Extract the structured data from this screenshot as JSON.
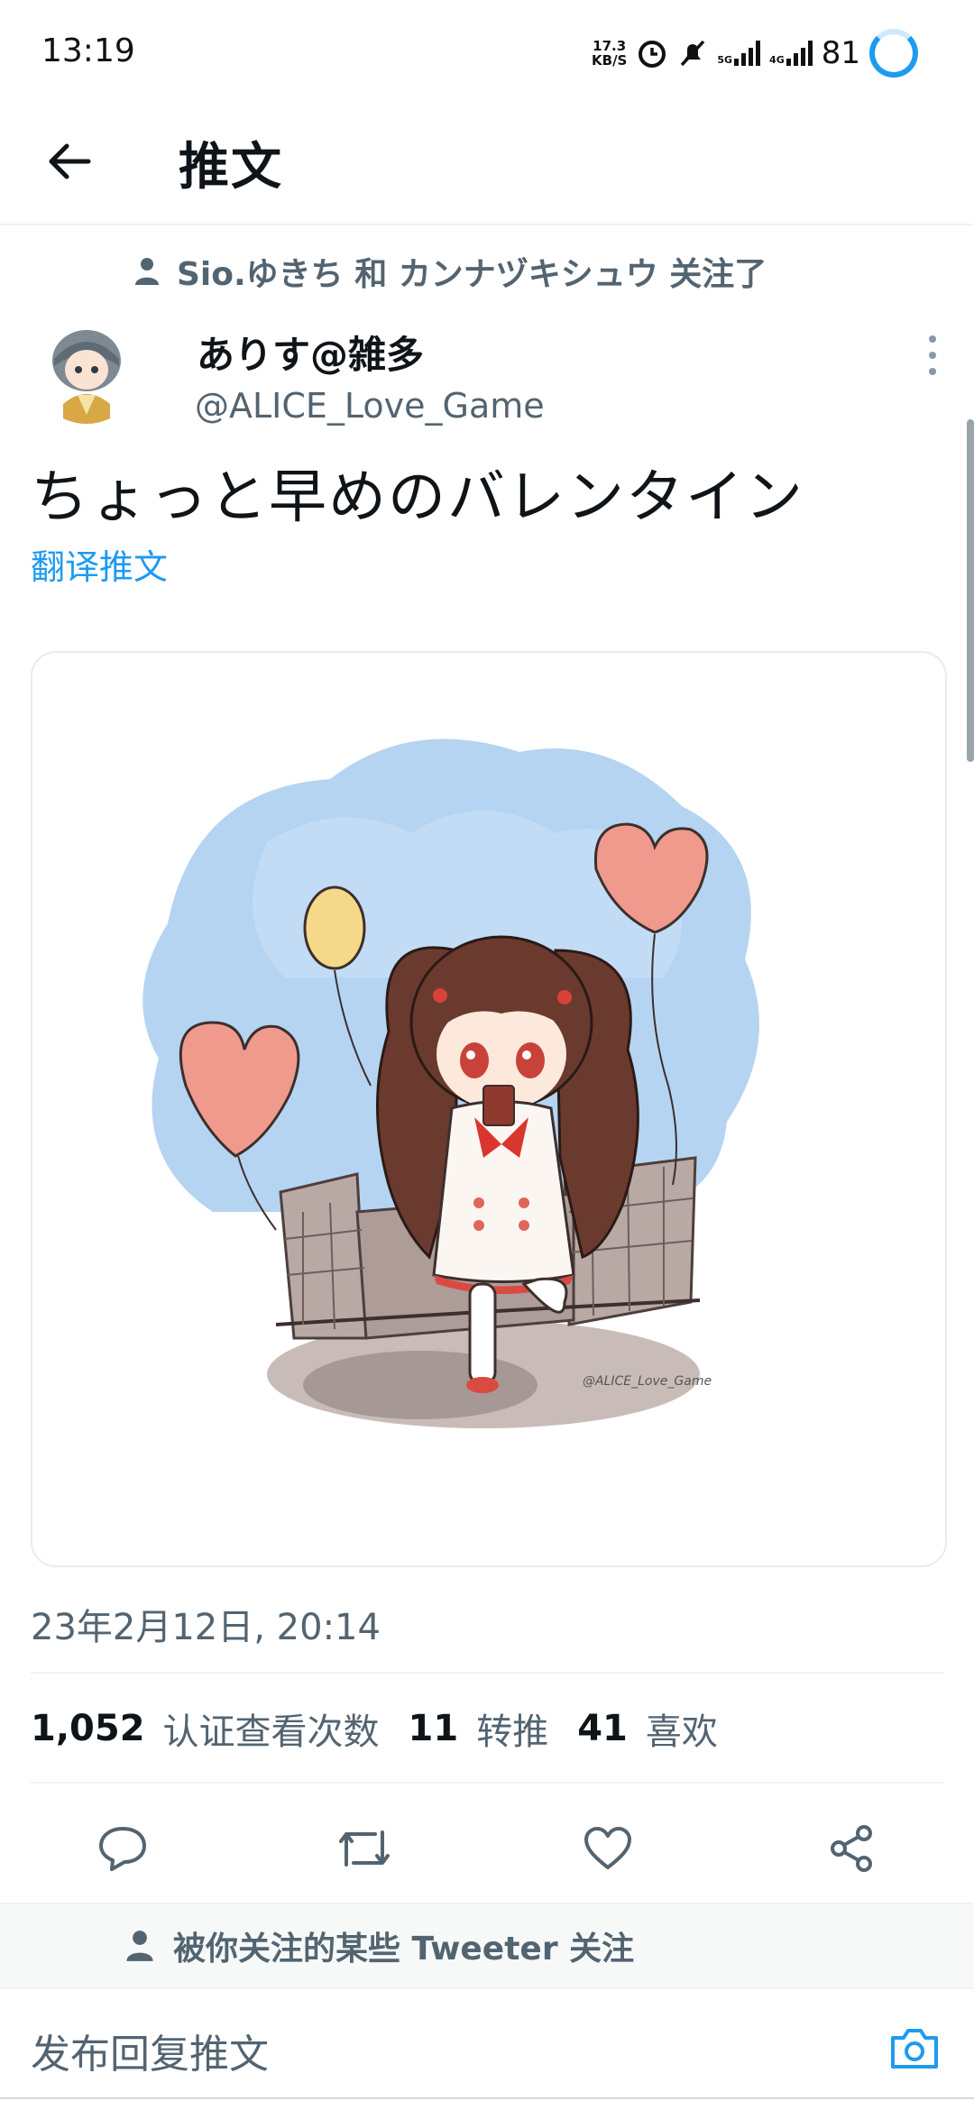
{
  "status_bar": {
    "time": "13:19",
    "net_speed_value": "17.3",
    "net_speed_unit": "KB/S",
    "signal_1": "5G",
    "signal_2": "4G",
    "battery": "81",
    "accent": "#1d9bf0"
  },
  "header": {
    "back_icon": "arrow-left-icon",
    "title": "推文"
  },
  "social_context": {
    "icon": "person-icon",
    "text": "Sio.ゆきち 和 カンナヅキシュウ 关注了"
  },
  "tweet": {
    "author_name": "ありす@雑多",
    "author_handle": "@ALICE_Love_Game",
    "text": "ちょっと早めのバレンタイン",
    "translate_label": "翻译推文",
    "image_watermark": "@ALICE_Love_Game",
    "timestamp": "23年2月12日, 20:14"
  },
  "stats": {
    "views_count": "1,052",
    "views_label": "认证查看次数",
    "retweets_count": "11",
    "retweets_label": "转推",
    "likes_count": "41",
    "likes_label": "喜欢"
  },
  "actions": [
    "reply-icon",
    "retweet-icon",
    "like-icon",
    "share-icon"
  ],
  "followed_by": {
    "icon": "person-icon",
    "text": "被你关注的某些 Tweeter 关注"
  },
  "reply": {
    "placeholder": "发布回复推文",
    "camera_icon": "camera-icon"
  },
  "colors": {
    "brand": "#1d9bf0",
    "secondary_text": "#536471",
    "primary_text": "#0f1419"
  }
}
